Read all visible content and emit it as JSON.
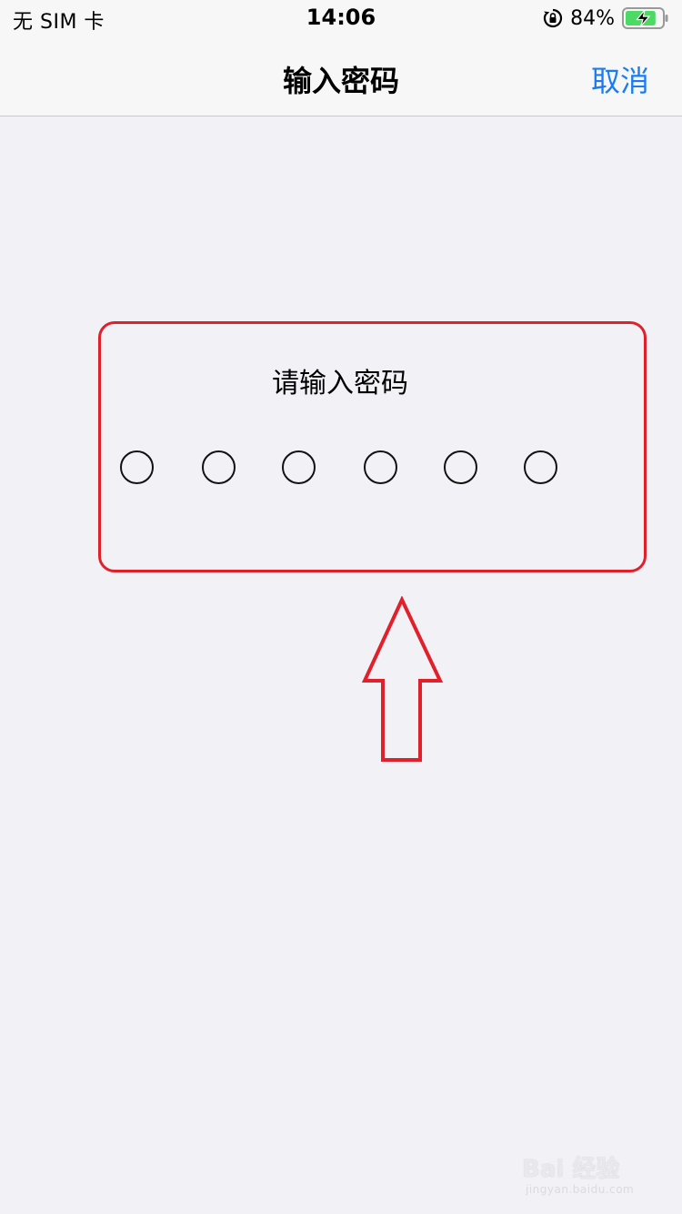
{
  "status_bar": {
    "carrier": "无 SIM 卡",
    "time": "14:06",
    "battery_percent": "84%",
    "battery_level": 0.84,
    "icons": [
      "orientation-lock-icon",
      "battery-charging-icon"
    ]
  },
  "nav_bar": {
    "title": "输入密码",
    "cancel_label": "取消"
  },
  "passcode": {
    "prompt": "请输入密码",
    "digits_total": 6,
    "digits_entered": 0
  },
  "annotation": {
    "frame_color": "#e0212c",
    "arrow_color": "#e0212c"
  },
  "watermark": {
    "main": "Bai 经验",
    "sub": "jingyan.baidu.com"
  },
  "colors": {
    "accent": "#1a7cf5",
    "background": "#f2f1f6",
    "battery_fill": "#4cd964"
  }
}
